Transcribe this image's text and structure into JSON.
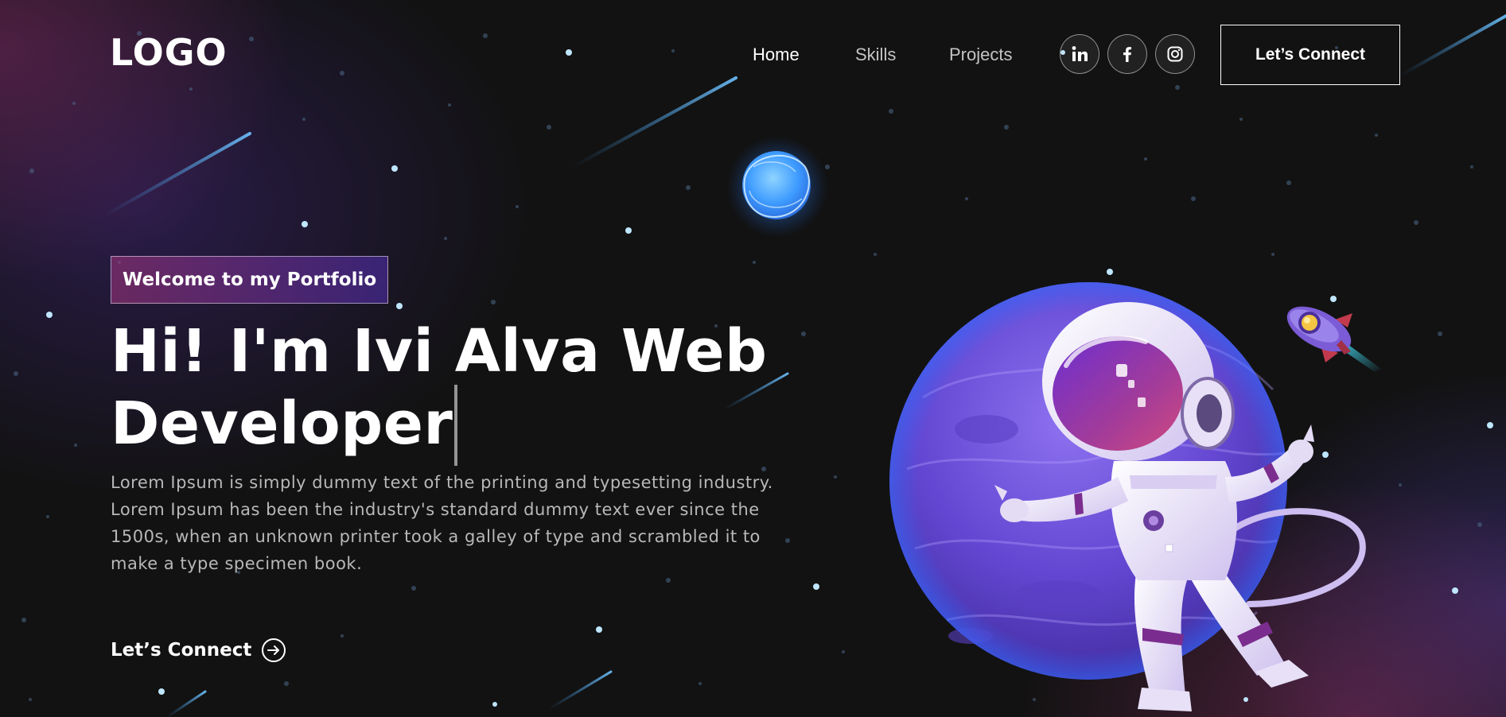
{
  "navbar": {
    "logo": "LOGO",
    "links": [
      {
        "label": "Home",
        "active": true
      },
      {
        "label": "Skills",
        "active": false
      },
      {
        "label": "Projects",
        "active": false
      }
    ],
    "social_icons": [
      "linkedin-icon",
      "facebook-icon",
      "instagram-icon"
    ],
    "connect_label": "Let’s Connect"
  },
  "hero": {
    "tagline": "Welcome to my Portfolio",
    "headline_line1": "Hi! I'm Ivi Alva Web",
    "headline_line2": "Developer",
    "description": "Lorem Ipsum is simply dummy text of the printing and typesetting industry. Lorem Ipsum has been the industry's standard dummy text ever since the 1500s, when an unknown printer took a galley of type and scrambled it to make a type specimen book.",
    "cta_label": "Let’s Connect",
    "cta_icon": "arrow-right-circle-icon"
  },
  "colors": {
    "background": "#121212",
    "accent_pink": "#AA367C",
    "accent_purple": "#4A2FBD",
    "text_muted": "#B8B8B8"
  }
}
